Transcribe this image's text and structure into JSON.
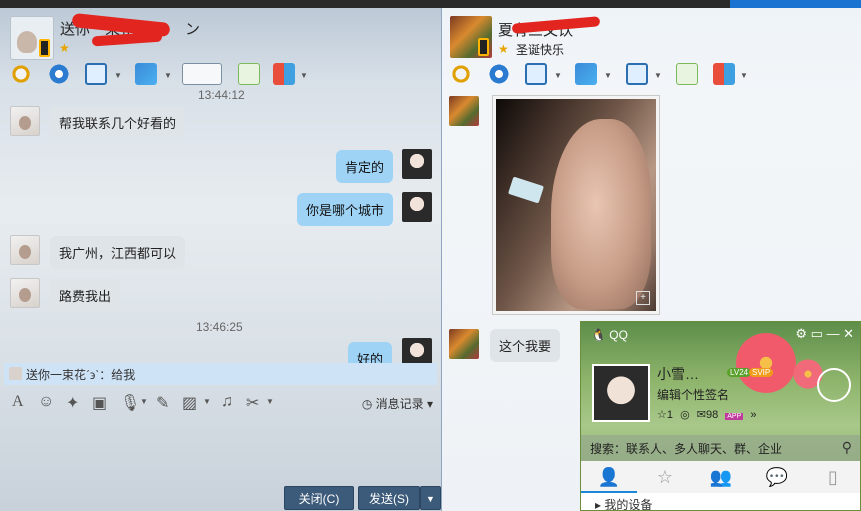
{
  "left_window": {
    "title": "送你一束花",
    "title_suffix": "ン",
    "time_top": "13:44:12",
    "messages": [
      {
        "from": "other",
        "text": "帮我联系几个好看的"
      },
      {
        "from": "self",
        "text": "肯定的"
      },
      {
        "from": "self",
        "text": "你是哪个城市"
      },
      {
        "from": "other",
        "text": "我广州，江西都可以"
      },
      {
        "from": "other",
        "text": "路费我出"
      },
      {
        "from": "self",
        "text": "好的"
      }
    ],
    "timestamp": "13:46:25",
    "notice": "送你一束花ˊ϶ˋ：给我",
    "history_label": "消息记录",
    "close_button": "关闭(C)",
    "send_button": "发送(S)"
  },
  "right_window": {
    "title": "夏有三文饮",
    "status": "圣诞快乐",
    "messages": [
      {
        "from": "other",
        "text": "这个我要"
      }
    ]
  },
  "qq_panel": {
    "app_label": "QQ",
    "nickname": "小雪…",
    "level": "LV24",
    "vip": "SVIP",
    "signature": "编辑个性签名",
    "star_count": "1",
    "mail_count": "98",
    "app_badge": "APP",
    "search_placeholder": "搜索：联系人、多人聊天、群、企业",
    "list_first": "我的设备"
  }
}
